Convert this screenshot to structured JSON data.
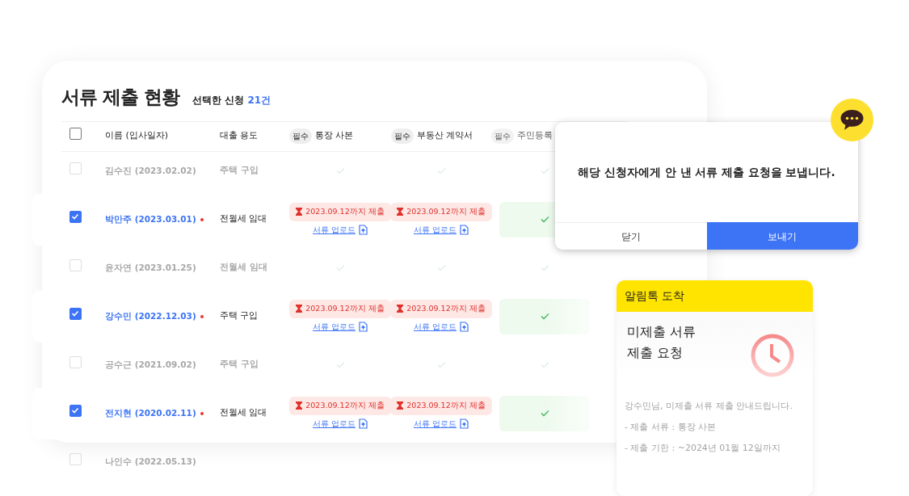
{
  "panel": {
    "title": "서류 제출 현황",
    "selected_label": "선택한 신청",
    "selected_count": "21건"
  },
  "table": {
    "all_checked": false,
    "columns": [
      {
        "label": "이름 (입사일자)"
      },
      {
        "label": "대출 용도"
      },
      {
        "tag": "필수",
        "label": "통장 사본"
      },
      {
        "tag": "필수",
        "label": "부동산 계약서"
      },
      {
        "tag": "필수",
        "label": "주민등록"
      }
    ],
    "rows": [
      {
        "selected": false,
        "name": "김수진 (2023.02.02)",
        "usage": "주택 구입",
        "docs": [
          {
            "kind": "done"
          },
          {
            "kind": "done"
          },
          {
            "kind": "done"
          }
        ]
      },
      {
        "selected": true,
        "flagged": true,
        "name": "박만주 (2023.03.01)",
        "usage": "전월세 임대",
        "docs": [
          {
            "kind": "deadline",
            "deadline": "2023.09.12까지 제출",
            "link": "서류 업로드"
          },
          {
            "kind": "deadline",
            "deadline": "2023.09.12까지 제출",
            "link": "서류 업로드"
          },
          {
            "kind": "done"
          }
        ]
      },
      {
        "selected": false,
        "name": "윤자연 (2023.01.25)",
        "usage": "전월세 임대",
        "docs": [
          {
            "kind": "done"
          },
          {
            "kind": "done"
          },
          {
            "kind": "done"
          }
        ]
      },
      {
        "selected": true,
        "flagged": true,
        "name": "강수민 (2022.12.03)",
        "usage": "주택 구입",
        "docs": [
          {
            "kind": "deadline",
            "deadline": "2023.09.12까지 제출",
            "link": "서류 업로드"
          },
          {
            "kind": "deadline",
            "deadline": "2023.09.12까지 제출",
            "link": "서류 업로드"
          },
          {
            "kind": "done"
          }
        ]
      },
      {
        "selected": false,
        "name": "공수근 (2021.09.02)",
        "usage": "주택 구입",
        "docs": [
          {
            "kind": "done"
          },
          {
            "kind": "done"
          },
          {
            "kind": "done"
          }
        ]
      },
      {
        "selected": true,
        "flagged": true,
        "name": "전지현 (2020.02.11)",
        "usage": "전월세 임대",
        "docs": [
          {
            "kind": "deadline",
            "deadline": "2023.09.12까지 제출",
            "link": "서류 업로드"
          },
          {
            "kind": "deadline",
            "deadline": "2023.09.12까지 제출",
            "link": "서류 업로드"
          },
          {
            "kind": "done"
          }
        ]
      },
      {
        "selected": false,
        "name": "나인수 (2022.05.13)"
      }
    ]
  },
  "dialog": {
    "message": "해당 신청자에게 안 낸 서류 제출 요청을 보냅니다.",
    "buttons": [
      {
        "label": "닫기",
        "kind": "secondary"
      },
      {
        "label": "보내기",
        "kind": "primary"
      }
    ]
  },
  "notification": {
    "header": "알림톡 도착",
    "title_lines": [
      "미제출 서류",
      "제출 요청"
    ],
    "body_lines": [
      "강수민님, 미제출 서류 제출 안내드립니다.",
      "- 제출 서류 : 통장 사본",
      "- 제출 기한 : ~2024년 01월 12일까지"
    ]
  }
}
